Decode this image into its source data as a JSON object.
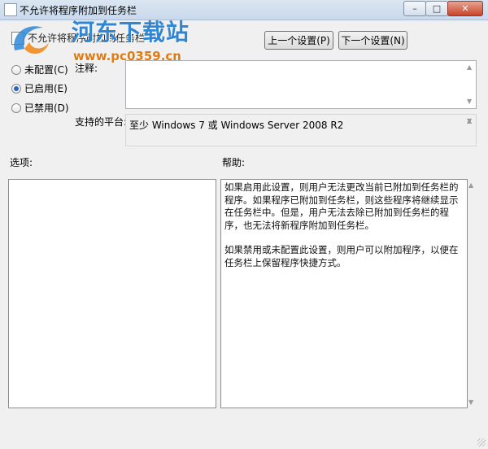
{
  "window": {
    "title": "不允许将程序附加到任务栏",
    "minimize_glyph": "–",
    "maximize_glyph": "□",
    "close_glyph": "✕"
  },
  "watermark": {
    "brand": "河东下载站",
    "url": "www.pc0359.cn"
  },
  "header": {
    "policy_name": "不允许将程序附加到任务栏",
    "prev_button": "上一个设置(P)",
    "next_button": "下一个设置(N)"
  },
  "state": {
    "options": [
      {
        "label": "未配置(C)",
        "selected": false
      },
      {
        "label": "已启用(E)",
        "selected": true
      },
      {
        "label": "已禁用(D)",
        "selected": false
      }
    ]
  },
  "comment": {
    "label": "注释:",
    "value": ""
  },
  "platform": {
    "label": "支持的平台:",
    "value": "至少 Windows 7 或 Windows Server 2008 R2"
  },
  "options_label": "选项:",
  "help": {
    "label": "帮助:",
    "paragraphs": [
      "如果启用此设置，则用户无法更改当前已附加到任务栏的程序。如果程序已附加到任务栏，则这些程序将继续显示在任务栏中。但是，用户无法去除已附加到任务栏的程序，也无法将新程序附加到任务栏。",
      "如果禁用或未配置此设置，则用户可以附加程序，以便在任务栏上保留程序快捷方式。"
    ]
  },
  "icons": {
    "app": "policy-icon",
    "watermark": "watermark-logo-icon"
  },
  "colors": {
    "accent": "#2a63c0",
    "brand": "#2f86d6",
    "url": "#e07a12"
  }
}
